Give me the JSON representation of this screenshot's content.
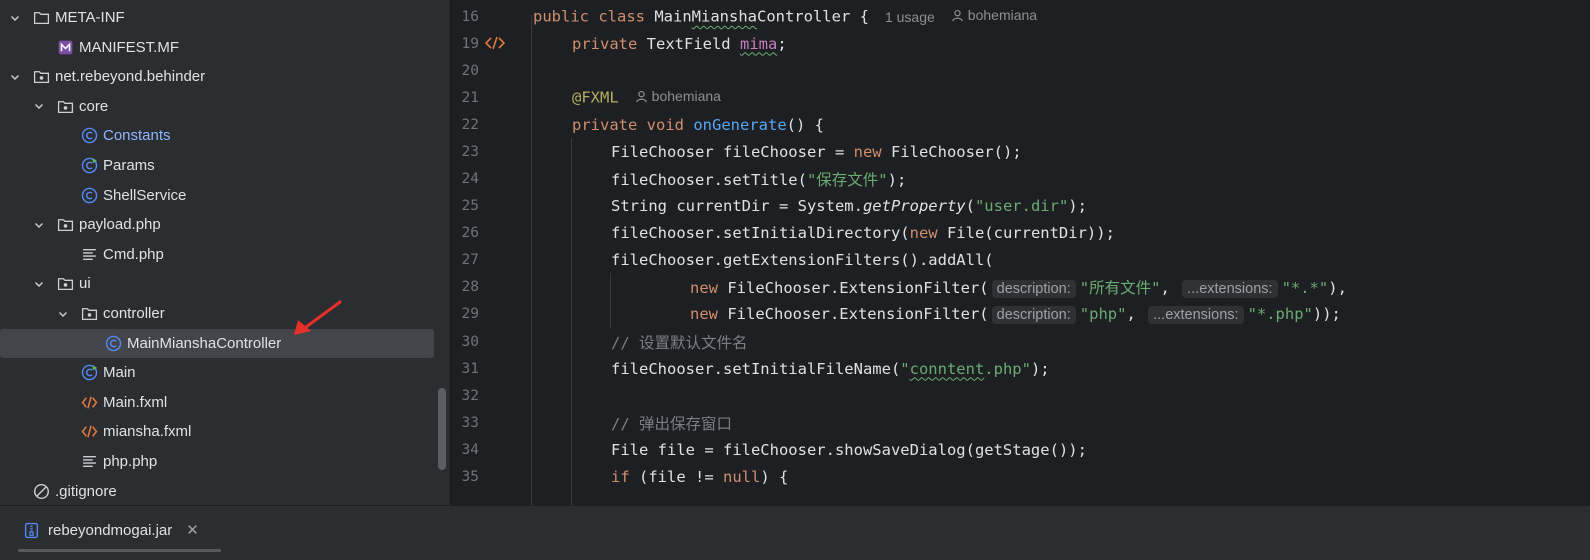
{
  "project_tree": [
    {
      "label": "META-INF",
      "icon": "folder-icon",
      "depth": 0,
      "expanded": true
    },
    {
      "label": "MANIFEST.MF",
      "icon": "manifest-file-icon",
      "depth": 1
    },
    {
      "label": "net.rebeyond.behinder",
      "icon": "package-icon",
      "depth": 0,
      "expanded": true
    },
    {
      "label": "core",
      "icon": "package-icon",
      "depth": 1,
      "expanded": true
    },
    {
      "label": "Constants",
      "icon": "class-icon",
      "depth": 2,
      "highlight": true
    },
    {
      "label": "Params",
      "icon": "runnable-class-icon",
      "depth": 2
    },
    {
      "label": "ShellService",
      "icon": "class-icon",
      "depth": 2
    },
    {
      "label": "payload.php",
      "icon": "package-icon",
      "depth": 1,
      "expanded": true
    },
    {
      "label": "Cmd.php",
      "icon": "text-file-icon",
      "depth": 2
    },
    {
      "label": "ui",
      "icon": "package-icon",
      "depth": 1,
      "expanded": true
    },
    {
      "label": "controller",
      "icon": "package-icon",
      "depth": 2,
      "expanded": true
    },
    {
      "label": "MainMianshaController",
      "icon": "class-icon",
      "depth": 3,
      "selected": true
    },
    {
      "label": "Main",
      "icon": "runnable-class-icon",
      "depth": 2
    },
    {
      "label": "Main.fxml",
      "icon": "xml-file-icon",
      "depth": 2
    },
    {
      "label": "miansha.fxml",
      "icon": "xml-file-icon",
      "depth": 2
    },
    {
      "label": "php.php",
      "icon": "text-file-icon",
      "depth": 2
    },
    {
      "label": ".gitignore",
      "icon": "ignore-file-icon",
      "depth": 0
    }
  ],
  "editor": {
    "line_16": {
      "num": "16",
      "t1": "public class ",
      "t2": "Main",
      "t3": "Miansha",
      "t4": "Controller {",
      "usages": "1 usage",
      "author": "bohemiana"
    },
    "line_19": {
      "num": "19",
      "t1": "private ",
      "t2": "TextField ",
      "t3": "mima",
      "t4": ";"
    },
    "line_20": {
      "num": "20"
    },
    "line_21": {
      "num": "21",
      "t1": "@FXML",
      "author": "bohemiana"
    },
    "line_22": {
      "num": "22",
      "t1": "private void ",
      "t2": "onGenerate",
      "t3": "() {"
    },
    "line_23": {
      "num": "23",
      "t1": "FileChooser fileChooser = ",
      "t2": "new ",
      "t3": "FileChooser();"
    },
    "line_24": {
      "num": "24",
      "t1": "fileChooser.setTitle(",
      "t2": "\"保存文件\"",
      "t3": ");"
    },
    "line_25": {
      "num": "25",
      "t1": "String currentDir = System.",
      "t2": "getProperty",
      "t3": "(",
      "t4": "\"user.dir\"",
      "t5": ");"
    },
    "line_26": {
      "num": "26",
      "t1": "fileChooser.setInitialDirectory(",
      "t2": "new ",
      "t3": "File(currentDir));"
    },
    "line_27": {
      "num": "27",
      "t1": "fileChooser.getExtensionFilters().addAll("
    },
    "line_28": {
      "num": "28",
      "t1": "new ",
      "t2": "FileChooser.ExtensionFilter(",
      "p1": "description:",
      "t3": "\"所有文件\"",
      "t4": ", ",
      "p2": "...extensions:",
      "t5": "\"*.*\"",
      "t6": "),"
    },
    "line_29": {
      "num": "29",
      "t1": "new ",
      "t2": "FileChooser.ExtensionFilter(",
      "p1": "description:",
      "t3": "\"php\"",
      "t4": ", ",
      "p2": "...extensions:",
      "t5": "\"*.php\"",
      "t6": "));"
    },
    "line_30": {
      "num": "30",
      "t1": "// 设置默认文件名"
    },
    "line_31": {
      "num": "31",
      "t1": "fileChooser.setInitialFileName(",
      "t2": "\"",
      "t3": "conntent",
      "t4": ".php\"",
      "t5": ");"
    },
    "line_32": {
      "num": "32"
    },
    "line_33": {
      "num": "33",
      "t1": "// 弹出保存窗口"
    },
    "line_34": {
      "num": "34",
      "t1": "File file = fileChooser.showSaveDialog(getStage());"
    },
    "line_35": {
      "num": "35",
      "t1": "if ",
      "t2": "(file != ",
      "t3": "null",
      "t4": ") {"
    }
  },
  "bottom_tab": {
    "label": "rebeyondmogai.jar",
    "close": "✕"
  },
  "colors": {
    "accent": "#3574f0",
    "keyword": "#cf8e6d",
    "string": "#6aab73",
    "function": "#56a8f5",
    "annotation": "#b3ae60",
    "field": "#c77dbb",
    "arrow": "#e5302a"
  }
}
